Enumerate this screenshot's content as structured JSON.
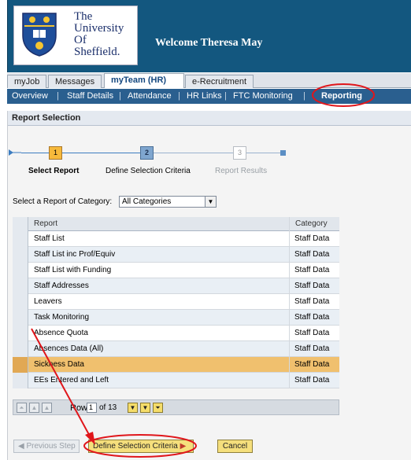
{
  "header": {
    "logo_lines": [
      "The",
      "University",
      "Of",
      "Sheffield."
    ],
    "welcome": "Welcome Theresa May"
  },
  "top_tabs": [
    {
      "label": "myJob",
      "active": false
    },
    {
      "label": "Messages",
      "active": false
    },
    {
      "label": "myTeam (HR)",
      "active": true
    },
    {
      "label": "e-Recruitment",
      "active": false
    }
  ],
  "sub_nav": [
    "Overview",
    "Staff Details",
    "Attendance",
    "HR Links",
    "FTC Monitoring",
    "Reporting"
  ],
  "panel_title": "Report Selection",
  "roadmap": {
    "steps": [
      {
        "number": "1",
        "label": "Select Report",
        "state": "current"
      },
      {
        "number": "2",
        "label": "Define Selection Criteria",
        "state": "next"
      },
      {
        "number": "3",
        "label": "Report Results",
        "state": "disabled"
      }
    ]
  },
  "category": {
    "label": "Select a Report of Category:",
    "value": "All Categories"
  },
  "table": {
    "headers": {
      "report": "Report",
      "category": "Category"
    },
    "rows": [
      {
        "report": "Staff List",
        "category": "Staff Data"
      },
      {
        "report": "Staff List inc Prof/Equiv",
        "category": "Staff Data"
      },
      {
        "report": "Staff List with Funding",
        "category": "Staff Data"
      },
      {
        "report": "Staff Addresses",
        "category": "Staff Data"
      },
      {
        "report": "Leavers",
        "category": "Staff Data"
      },
      {
        "report": "Task Monitoring",
        "category": "Staff Data"
      },
      {
        "report": "Absence Quota",
        "category": "Staff Data"
      },
      {
        "report": "Absences Data (All)",
        "category": "Staff Data"
      },
      {
        "report": "Sickness Data",
        "category": "Staff Data",
        "selected": true
      },
      {
        "report": "EEs Entered and Left",
        "category": "Staff Data"
      }
    ]
  },
  "pager": {
    "row_label": "Row",
    "row_value": "1",
    "of_label": "of 13"
  },
  "buttons": {
    "previous": "Previous Step",
    "define": "Define Selection Criteria",
    "cancel": "Cancel"
  },
  "colors": {
    "header_blue": "#13577f",
    "subnav_blue": "#2a5f8f",
    "selected_row": "#f0c06e",
    "button_yellow": "#f5df7c",
    "annotation_red": "#e0161b"
  }
}
